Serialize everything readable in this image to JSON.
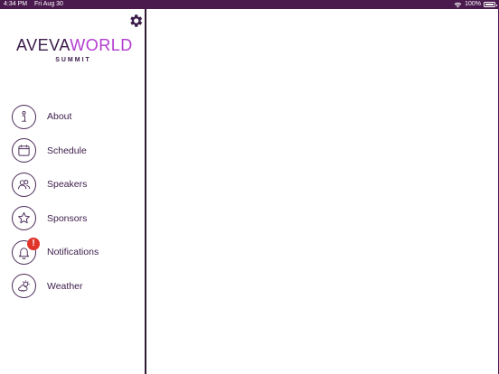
{
  "status_bar": {
    "time": "4:34 PM",
    "date": "Fri Aug 30",
    "battery": "100%",
    "battery_level": 1.0,
    "wifi_icon": "wifi-icon",
    "battery_icon": "battery-icon"
  },
  "header": {
    "settings_icon": "gear-icon"
  },
  "logo": {
    "part1": "AVEVA",
    "part2": "WORLD",
    "subtitle": "SUMMIT"
  },
  "menu": {
    "items": [
      {
        "label": "About",
        "icon": "info-icon"
      },
      {
        "label": "Schedule",
        "icon": "calendar-icon"
      },
      {
        "label": "Speakers",
        "icon": "people-icon"
      },
      {
        "label": "Sponsors",
        "icon": "star-icon"
      },
      {
        "label": "Notifications",
        "icon": "bell-icon",
        "badge": "!"
      },
      {
        "label": "Weather",
        "icon": "weather-icon"
      }
    ]
  },
  "colors": {
    "status_bar": "#4a1a4e",
    "brand_dark": "#3b1c4a",
    "brand_accent": "#b33ccf",
    "badge": "#e0342a"
  }
}
